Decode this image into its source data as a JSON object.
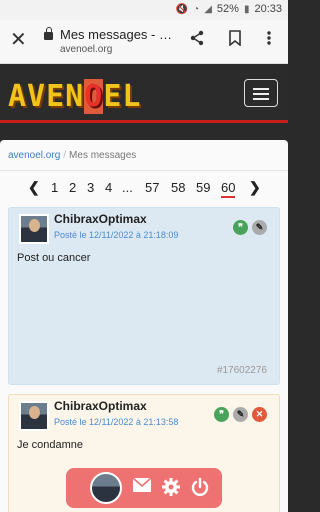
{
  "status_bar": {
    "battery": "52%",
    "time": "20:33"
  },
  "browser": {
    "page_title": "Mes messages - …",
    "url": "avenoel.org"
  },
  "site": {
    "logo_part1": "AVEN",
    "logo_part2": "O",
    "logo_part3": "EL"
  },
  "breadcrumb": {
    "home": "avenoel.org",
    "separator": "/",
    "current": "Mes messages"
  },
  "pagination": {
    "prev": "❮",
    "next": "❯",
    "pages": [
      "1",
      "2",
      "3",
      "4",
      "...",
      "57",
      "58",
      "59",
      "60"
    ],
    "active": "60"
  },
  "posts": [
    {
      "author": "ChibraxOptimax",
      "posted": "Posté le 12/11/2022 à 21:18:09",
      "text": "Post ou cancer",
      "id": "#17602276"
    },
    {
      "author": "ChibraxOptimax",
      "posted": "Posté le 12/11/2022 à 21:13:58",
      "text": "Je condamne"
    }
  ],
  "icons": {
    "quote": "quote-icon",
    "edit": "pencil-icon",
    "delete": "close-icon",
    "mail": "mail-icon",
    "settings": "gear-icon",
    "power": "power-icon"
  },
  "colors": {
    "accent_red": "#c81d1d",
    "link_blue": "#3a7fc4",
    "userbar": "#ef7272"
  }
}
